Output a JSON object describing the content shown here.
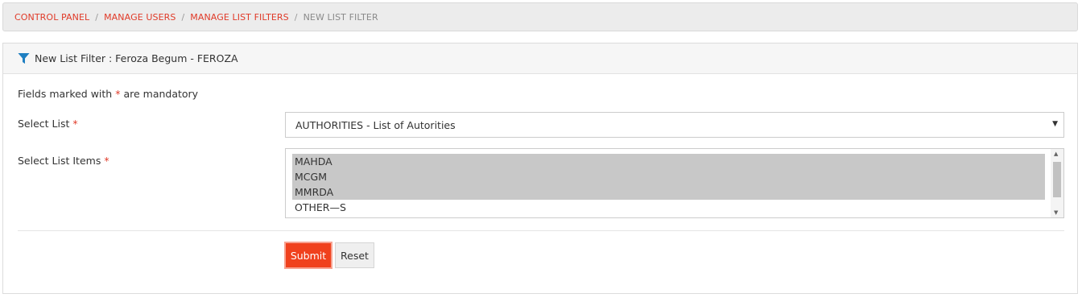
{
  "breadcrumb": {
    "items": [
      "CONTROL PANEL",
      "MANAGE USERS",
      "MANAGE LIST FILTERS"
    ],
    "current": "NEW LIST FILTER",
    "separator": "/"
  },
  "panel": {
    "title": "New List Filter : Feroza Begum - FEROZA",
    "icon": "filter-icon"
  },
  "form": {
    "mandatory_prefix": "Fields marked with",
    "mandatory_star": "*",
    "mandatory_suffix": "are mandatory",
    "select_list_label": "Select List",
    "select_list_value": "AUTHORITIES - List of Autorities",
    "select_items_label": "Select List Items",
    "items": [
      {
        "label": "MAHDA",
        "selected": true
      },
      {
        "label": "MCGM",
        "selected": true
      },
      {
        "label": "MMRDA",
        "selected": true
      },
      {
        "label": "OTHER—S",
        "selected": false
      }
    ]
  },
  "actions": {
    "submit_label": "Submit",
    "reset_label": "Reset"
  },
  "colors": {
    "accent": "#e03a28",
    "submit_bg": "#f0411d",
    "filter_icon": "#1f7fc1"
  }
}
